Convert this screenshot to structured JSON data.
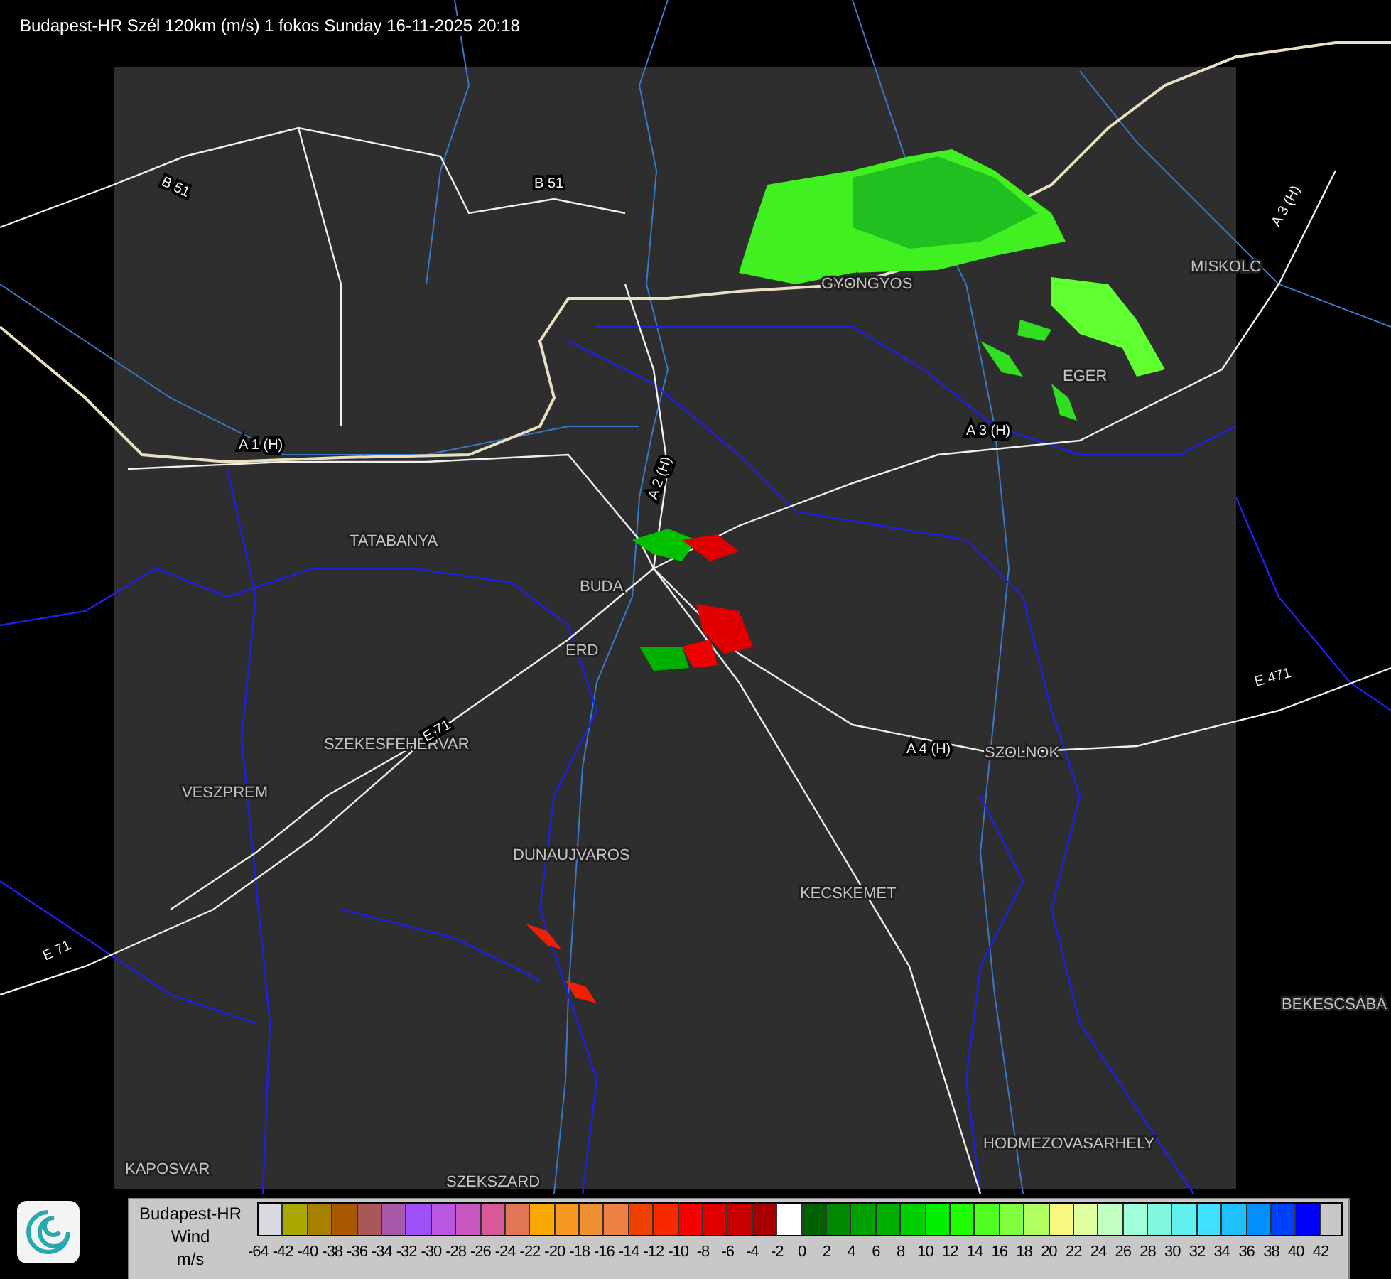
{
  "title": "Budapest-HR Szél 120km (m/s) 1 fokos Sunday 16-11-2025 20:18",
  "map": {
    "places": [
      {
        "name": "TATABANYA"
      },
      {
        "name": "BUDA"
      },
      {
        "name": "ERD"
      },
      {
        "name": "SZEKESFEHERVAR"
      },
      {
        "name": "VESZPREM"
      },
      {
        "name": "DUNAUJVAROS"
      },
      {
        "name": "KECSKEMET"
      },
      {
        "name": "EGER"
      },
      {
        "name": "GYONGYOS"
      },
      {
        "name": "MISKOLC"
      },
      {
        "name": "SZOLNOK"
      },
      {
        "name": "BEKESCSABA"
      },
      {
        "name": "HODMEZOVASARHELY"
      },
      {
        "name": "KAPOSVAR"
      },
      {
        "name": "SZEKSZARD"
      }
    ],
    "roads": [
      {
        "label": "B 51"
      },
      {
        "label": "B 51"
      },
      {
        "label": "A 1 (H)"
      },
      {
        "label": "A 2 (H)"
      },
      {
        "label": "A 3 (H)"
      },
      {
        "label": "A 3 (H)"
      },
      {
        "label": "A 4 (H)"
      },
      {
        "label": "E 471"
      },
      {
        "label": "E 71"
      },
      {
        "label": "E 71"
      }
    ]
  },
  "legend": {
    "lines": [
      "Budapest-HR",
      "Wind",
      "m/s"
    ],
    "swatches": [
      {
        "color": "#d8d8e0"
      },
      {
        "color": "#a8a800"
      },
      {
        "color": "#a88000"
      },
      {
        "color": "#a85800"
      },
      {
        "color": "#a85858"
      },
      {
        "color": "#a858a8"
      },
      {
        "color": "#a050f8"
      },
      {
        "color": "#b858e0"
      },
      {
        "color": "#c858c0"
      },
      {
        "color": "#d85898"
      },
      {
        "color": "#e07858"
      },
      {
        "color": "#f8a800"
      },
      {
        "color": "#f89820"
      },
      {
        "color": "#f09030"
      },
      {
        "color": "#f08040"
      },
      {
        "color": "#f04000"
      },
      {
        "color": "#f82800"
      },
      {
        "color": "#f80000"
      },
      {
        "color": "#e00000"
      },
      {
        "color": "#c80000"
      },
      {
        "color": "#a80000"
      },
      {
        "color": "#ffffff"
      },
      {
        "color": "#006000"
      },
      {
        "color": "#008800"
      },
      {
        "color": "#00a000"
      },
      {
        "color": "#00b000"
      },
      {
        "color": "#00d000"
      },
      {
        "color": "#00f000"
      },
      {
        "color": "#20ff00"
      },
      {
        "color": "#50ff20"
      },
      {
        "color": "#80ff40"
      },
      {
        "color": "#b0ff60"
      },
      {
        "color": "#f8f880"
      },
      {
        "color": "#e0ffa0"
      },
      {
        "color": "#c0ffc0"
      },
      {
        "color": "#a0ffd8"
      },
      {
        "color": "#80f8e0"
      },
      {
        "color": "#60f0f0"
      },
      {
        "color": "#40e0ff"
      },
      {
        "color": "#20c0ff"
      },
      {
        "color": "#0090ff"
      },
      {
        "color": "#0040ff"
      },
      {
        "color": "#0000ff"
      }
    ],
    "labels": [
      "-64",
      "-42",
      "-40",
      "-38",
      "-36",
      "-34",
      "-32",
      "-30",
      "-28",
      "-26",
      "-24",
      "-22",
      "-20",
      "-18",
      "-16",
      "-14",
      "-12",
      "-10",
      "-8",
      "-6",
      "-4",
      "-2",
      "0",
      "2",
      "4",
      "6",
      "8",
      "10",
      "12",
      "14",
      "16",
      "18",
      "20",
      "22",
      "24",
      "26",
      "28",
      "30",
      "32",
      "34",
      "36",
      "38",
      "40",
      "42"
    ]
  }
}
